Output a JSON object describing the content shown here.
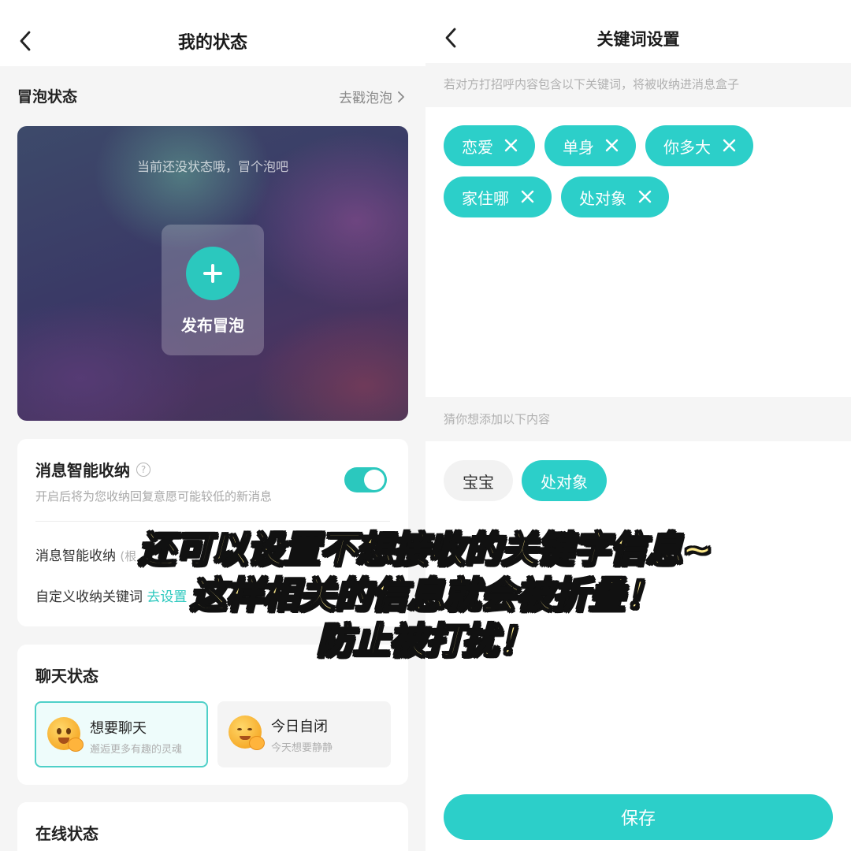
{
  "left": {
    "title": "我的状态",
    "bubble": {
      "heading": "冒泡状态",
      "link": "去戳泡泡",
      "empty_text": "当前还没状态哦，冒个泡吧",
      "publish_label": "发布冒泡"
    },
    "message": {
      "title": "消息智能收纳",
      "help": "?",
      "subtitle": "开启后将为您收纳回复意愿可能较低的新消息",
      "toggle_on": true,
      "row1_label": "消息智能收纳",
      "row1_muted": "(根",
      "row2_label": "自定义收纳关键词",
      "row2_link": "去设置"
    },
    "chat": {
      "title": "聊天状态",
      "options": [
        {
          "title": "想要聊天",
          "subtitle": "邂逅更多有趣的灵魂",
          "selected": true
        },
        {
          "title": "今日自闭",
          "subtitle": "今天想要静静",
          "selected": false
        }
      ]
    },
    "online": {
      "title": "在线状态"
    }
  },
  "right": {
    "title": "关键词设置",
    "hint": "若对方打招呼内容包含以下关键词，将被收纳进消息盒子",
    "keywords": [
      "恋爱",
      "单身",
      "你多大",
      "家住哪",
      "处对象"
    ],
    "suggest_title": "猜你想添加以下内容",
    "suggestions": [
      {
        "label": "宝宝",
        "added": false
      },
      {
        "label": "处对象",
        "added": true
      }
    ],
    "save_label": "保存"
  },
  "caption": {
    "line1": "还可以设置不想接收的关键字信息~",
    "line2": "这样相关的信息就会被折叠！",
    "line3": "防止被打扰！"
  },
  "colors": {
    "accent": "#2ccfc9",
    "caption_fill": "#fde98a"
  }
}
